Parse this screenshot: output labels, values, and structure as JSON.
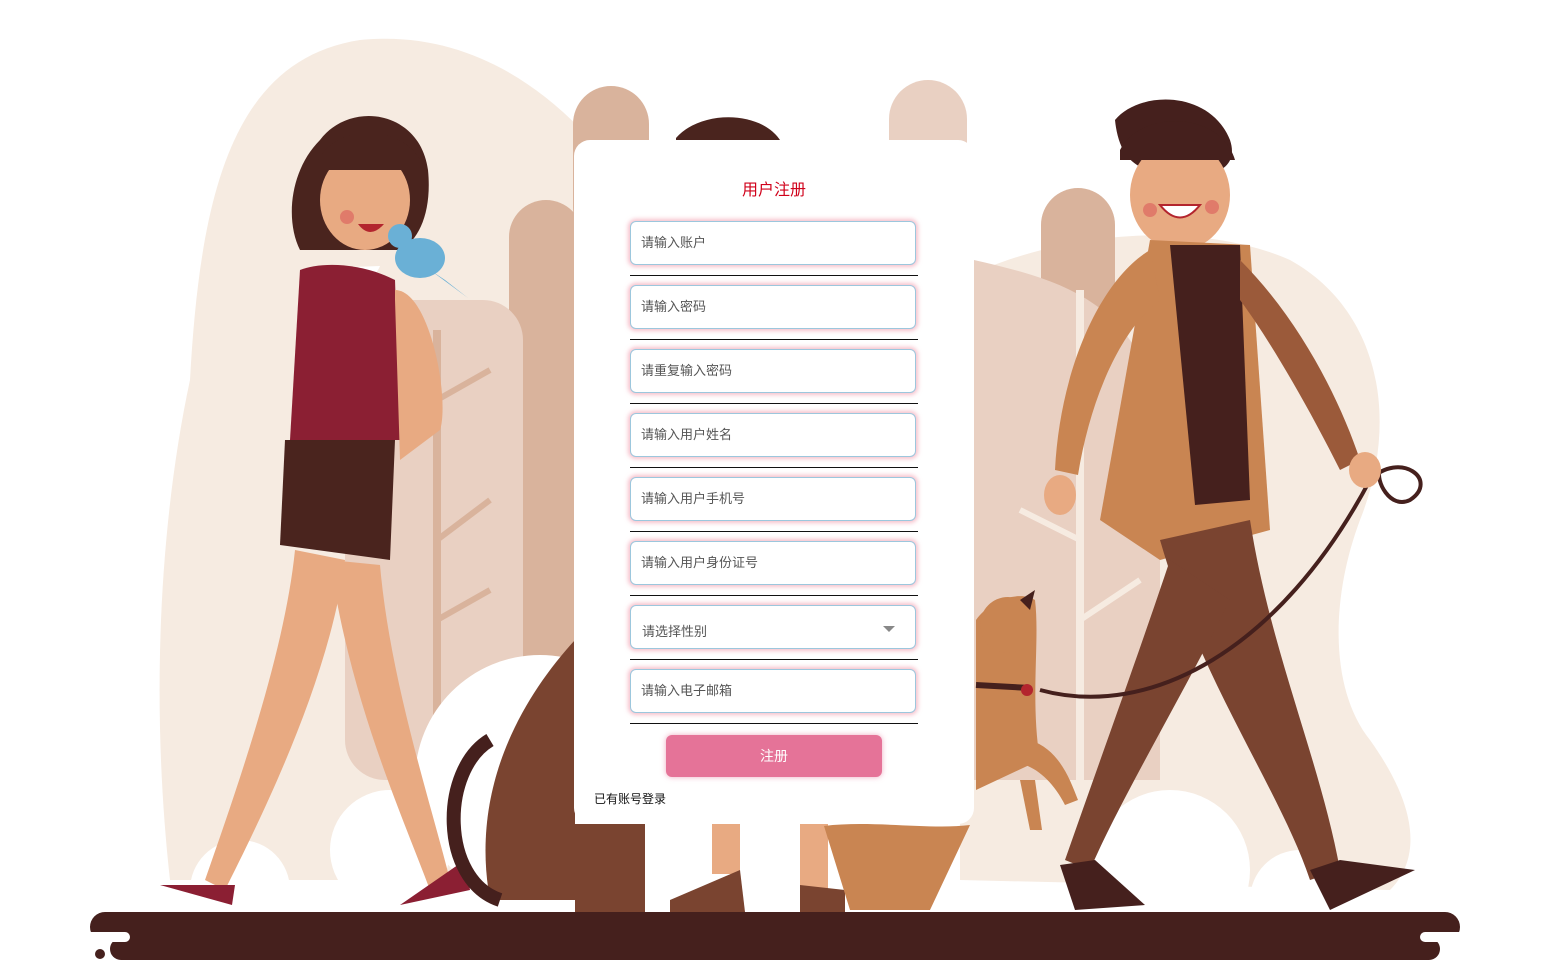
{
  "form": {
    "title": "用户注册",
    "fields": [
      {
        "placeholder": "请输入账户"
      },
      {
        "placeholder": "请输入密码"
      },
      {
        "placeholder": "请重复输入密码"
      },
      {
        "placeholder": "请输入用户姓名"
      },
      {
        "placeholder": "请输入用户手机号"
      },
      {
        "placeholder": "请输入用户身份证号"
      }
    ],
    "gender_select": {
      "placeholder": "请选择性别"
    },
    "email": {
      "placeholder": "请输入电子邮箱"
    },
    "submit_label": "注册",
    "login_link": "已有账号登录"
  },
  "colors": {
    "title": "#d0021b",
    "button": "#e57398",
    "ground": "#45201d",
    "background_blob": "#f6ebe1"
  },
  "icons": {
    "select_caret": "chevron-down-icon"
  }
}
